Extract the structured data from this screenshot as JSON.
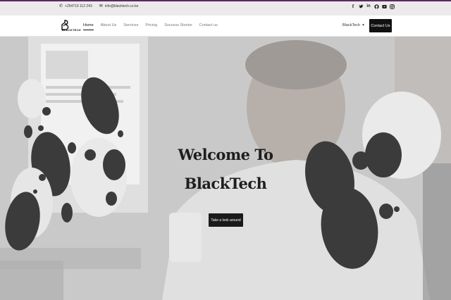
{
  "topbar": {
    "phone_icon": "phone-icon",
    "phone": "+254719 112 243",
    "email_icon": "envelope-icon",
    "email": "info@blacktech.co.ke",
    "social": [
      {
        "icon": "facebook-icon",
        "glyph": "f"
      },
      {
        "icon": "twitter-icon",
        "glyph": "🐦"
      },
      {
        "icon": "linkedin-icon",
        "glyph": "in"
      },
      {
        "icon": "github-icon",
        "glyph": "◉"
      },
      {
        "icon": "youtube-icon",
        "glyph": "▶"
      },
      {
        "icon": "instagram-icon",
        "glyph": "◎"
      }
    ]
  },
  "nav": {
    "logo_text": "BLACKTECH",
    "items": [
      {
        "label": "Home",
        "active": true
      },
      {
        "label": "About Us",
        "active": false
      },
      {
        "label": "Services",
        "active": false
      },
      {
        "label": "Pricing",
        "active": false
      },
      {
        "label": "Success Stories",
        "active": false
      },
      {
        "label": "Contact us",
        "active": false
      }
    ],
    "brand_dropdown": "BlackTech",
    "contact_button": "Contact Us"
  },
  "hero": {
    "title_line1": "Welcome To",
    "title_line2": "BlackTech",
    "cta_button": "Take a look around"
  },
  "colors": {
    "accent_bar": "#5b2a5e",
    "dark": "#111111",
    "hero_overlay": "#b9b9b9"
  }
}
